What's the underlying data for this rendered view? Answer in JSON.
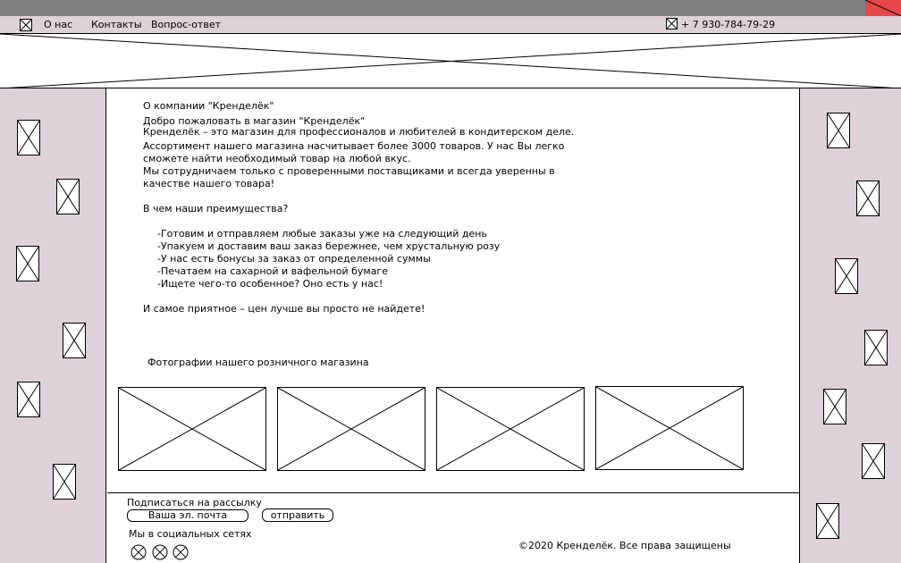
{
  "nav": {
    "items": [
      "О нас",
      "Контакты",
      "Вопрос-ответ"
    ],
    "phone": "+ 7 930-784-79-29"
  },
  "about": {
    "heading": "О компании \"Кренделёк\"",
    "welcome": "Добро пожаловать в магазин \"Кренделёк\"",
    "intro": [
      "Кренделёк – это магазин для профессионалов и любителей в кондитерском деле.",
      "Ассортимент нашего магазина насчитывает более 3000 товаров. У нас Вы легко",
      "сможете найти необходимый товар на любой вкус.",
      "Мы сотрудничаем только с проверенными поставщиками и всегда уверенны в",
      "качестве нашего товара!"
    ],
    "advantages_title": "В чем наши преимущества?",
    "advantages": [
      "-Готовим и отправляем любые заказы уже на следующий день",
      "-Упакуем и доставим ваш заказ бережнее, чем хрустальную розу",
      "-У нас есть бонусы за заказ от определенной суммы",
      "-Печатаем на сахарной и вафельной бумаге",
      "-Ищете чего-то особенное? Оно есть у нас!"
    ],
    "closing": "И самое приятное – цен лучше вы просто не найдете!"
  },
  "photos": {
    "title": "Фотографии нашего розничного магазина"
  },
  "footer": {
    "subscribe_label": "Подписаться на рассылку",
    "email_placeholder": "Ваша эл. почта",
    "send_label": "отправить",
    "social_label": "Мы в социальных сетях",
    "copyright": "©2020 Кренделёк. Все права защищены"
  }
}
